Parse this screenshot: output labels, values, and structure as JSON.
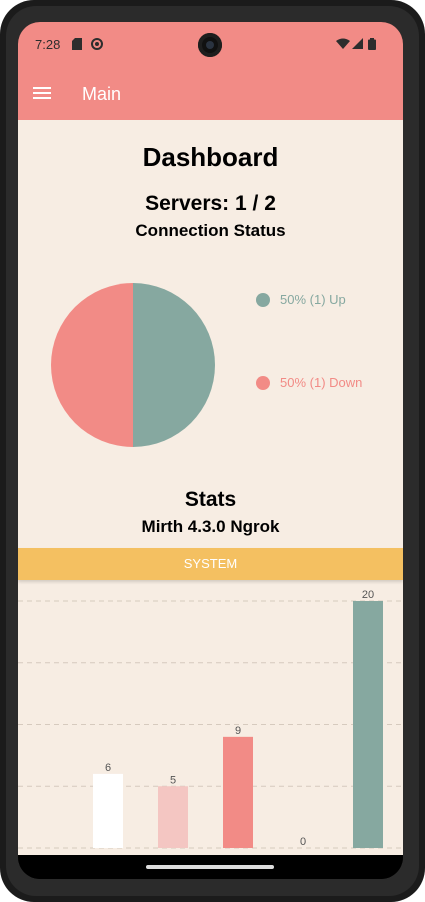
{
  "status_bar": {
    "time": "7:28"
  },
  "app_bar": {
    "title": "Main"
  },
  "dashboard": {
    "title": "Dashboard",
    "servers": "Servers: 1 / 2",
    "connection_status": "Connection Status",
    "stats_title": "Stats",
    "server_name": "Mirth 4.3.0 Ngrok",
    "system_tab": "SYSTEM"
  },
  "colors": {
    "accent": "#f28b86",
    "up": "#86a8a0",
    "down": "#f28b86",
    "system": "#f4c061",
    "background": "#f7ede3"
  },
  "chart_data": [
    {
      "type": "pie",
      "labels": [
        "50% (1) Up",
        "50% (1) Down"
      ],
      "values": [
        1,
        1
      ],
      "colors": [
        "#86a8a0",
        "#f28b86"
      ],
      "legend": "right"
    },
    {
      "type": "bar",
      "values": [
        6,
        5,
        9,
        0,
        20
      ],
      "colors": [
        "#ffffff",
        "#f4c6c2",
        "#f28b86",
        "#86a8a0",
        "#86a8a0"
      ],
      "ylim": [
        0,
        20
      ],
      "grid": true
    }
  ]
}
